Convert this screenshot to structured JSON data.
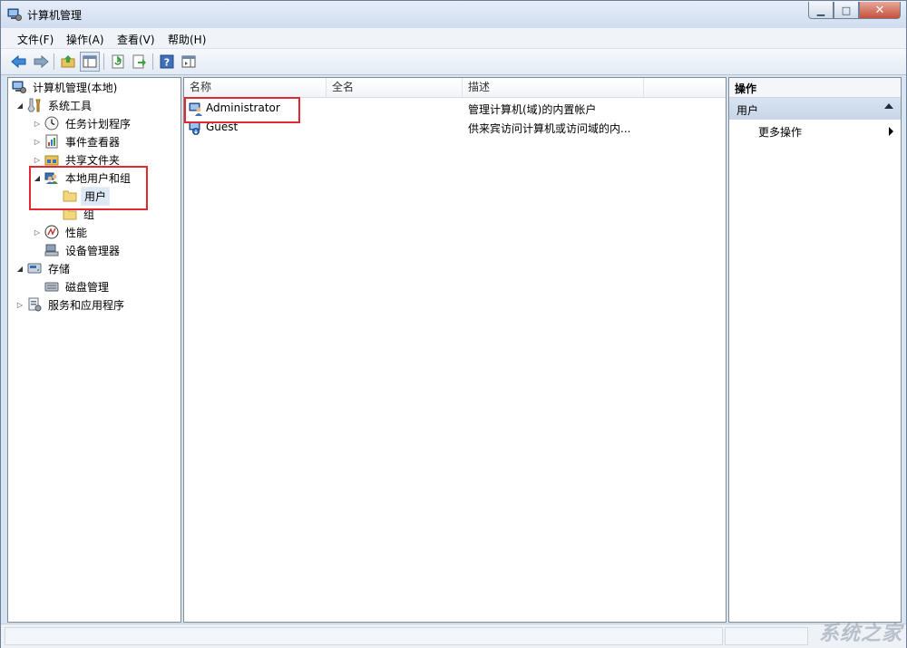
{
  "window": {
    "title": "计算机管理"
  },
  "menu": [
    "文件(F)",
    "操作(A)",
    "查看(V)",
    "帮助(H)"
  ],
  "tree": [
    {
      "label": "计算机管理(本地)",
      "icon": "computer-management-icon",
      "expander": ""
    },
    {
      "label": "系统工具",
      "icon": "tools-icon",
      "expander": "open"
    },
    {
      "label": "任务计划程序",
      "icon": "clock-icon",
      "expander": "closed"
    },
    {
      "label": "事件查看器",
      "icon": "event-viewer-icon",
      "expander": "closed"
    },
    {
      "label": "共享文件夹",
      "icon": "shared-folder-icon",
      "expander": "closed"
    },
    {
      "label": "本地用户和组",
      "icon": "users-group-icon",
      "expander": "open"
    },
    {
      "label": "用户",
      "icon": "folder-icon",
      "expander": ""
    },
    {
      "label": "组",
      "icon": "folder-icon",
      "expander": ""
    },
    {
      "label": "性能",
      "icon": "performance-icon",
      "expander": "closed"
    },
    {
      "label": "设备管理器",
      "icon": "device-manager-icon",
      "expander": ""
    },
    {
      "label": "存储",
      "icon": "storage-icon",
      "expander": "open"
    },
    {
      "label": "磁盘管理",
      "icon": "disk-icon",
      "expander": ""
    },
    {
      "label": "服务和应用程序",
      "icon": "services-icon",
      "expander": "closed"
    }
  ],
  "list": {
    "columns": [
      "名称",
      "全名",
      "描述"
    ],
    "rows": [
      {
        "name": "Administrator",
        "fullname": "",
        "description": "管理计算机(域)的内置帐户",
        "icon": "user-icon"
      },
      {
        "name": "Guest",
        "fullname": "",
        "description": "供来宾访问计算机或访问域的内...",
        "icon": "user-icon"
      }
    ]
  },
  "actions": {
    "header": "操作",
    "section": "用户",
    "more": "更多操作"
  },
  "watermark": "系统之家",
  "colors": {
    "highlight_box": "#e2292e",
    "selection": "#dde9f7"
  }
}
